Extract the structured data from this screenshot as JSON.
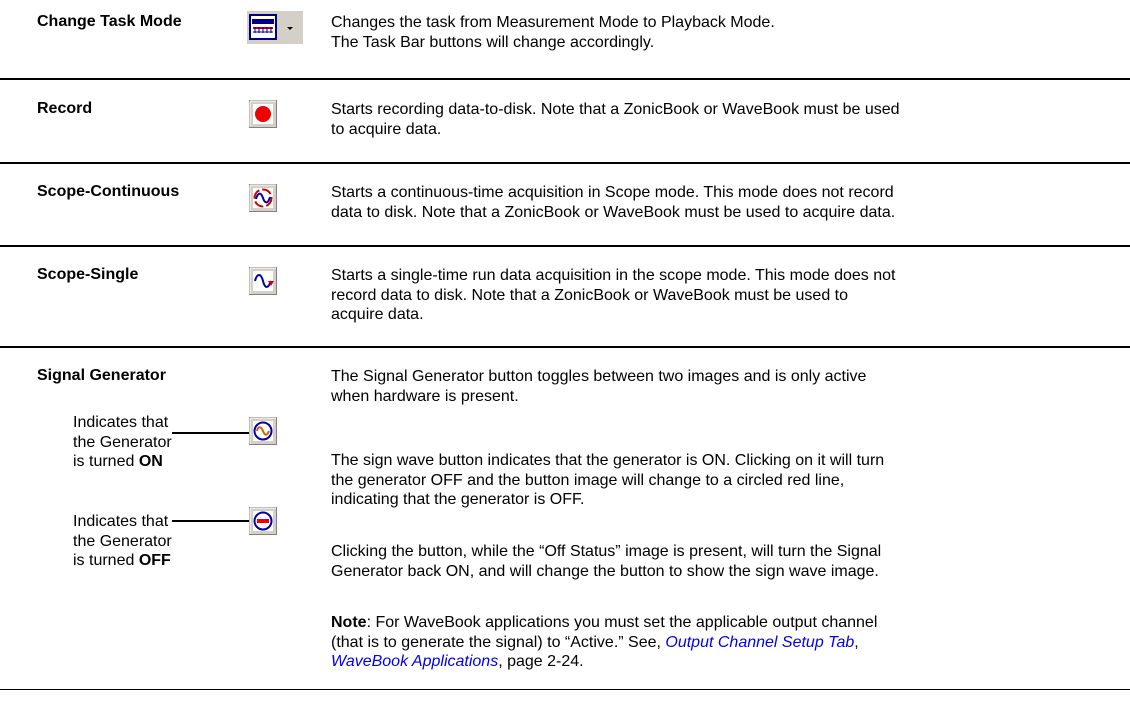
{
  "rows": [
    {
      "title": "Change Task Mode",
      "icon": "measurement-mode-dropdown-icon",
      "desc_lines": [
        "Changes the task from Measurement Mode to Playback Mode.",
        "The Task Bar buttons will change accordingly."
      ]
    },
    {
      "title": "Record",
      "icon": "record-icon",
      "desc_lines": [
        "Starts recording data-to-disk.  Note that a ZonicBook or WaveBook must be used",
        "to acquire data."
      ]
    },
    {
      "title": "Scope-Continuous",
      "icon": "scope-continuous-icon",
      "desc_lines": [
        "Starts a continuous-time acquisition in Scope mode.  This mode does not record",
        "data to disk.  Note that a ZonicBook or WaveBook must be used to acquire data."
      ]
    },
    {
      "title": "Scope-Single",
      "icon": "scope-single-icon",
      "desc_lines": [
        "Starts a single-time run data acquisition in the scope mode.  This mode does not",
        "record data to disk.  Note that a ZonicBook or WaveBook must be used to",
        "acquire data."
      ]
    }
  ],
  "signal": {
    "title": "Signal Generator",
    "intro_lines": [
      "The Signal Generator button toggles between two images and is only active",
      "when hardware is present."
    ],
    "on_label": {
      "line1": "Indicates that",
      "line2": "the Generator",
      "line3_prefix": "is turned ",
      "line3_bold": "ON"
    },
    "off_label": {
      "line1": "Indicates that",
      "line2": "the Generator",
      "line3_prefix": "is turned ",
      "line3_bold": "OFF"
    },
    "on_desc_lines": [
      "The sign wave button indicates that the generator is ON.  Clicking on it will turn",
      "the generator OFF and the button image will change to a circled red line,",
      "indicating that the generator is OFF."
    ],
    "off_desc_lines": [
      "Clicking the button, while the “Off Status” image is present, will turn the Signal",
      "Generator back ON, and will change the button to show the sign wave image."
    ],
    "note": {
      "label": "Note",
      "line1": ":  For WaveBook applications you must set the applicable output channel",
      "line2_prefix": "(that is to generate the signal) to “Active.”  See, ",
      "link1": "Output Channel Setup Tab",
      "line2_suffix": ",",
      "link2": "WaveBook Applications",
      "line3_suffix": ", page 2-24."
    }
  },
  "colors": {
    "record_red": "#ee0000",
    "icon_blue": "#0000aa",
    "button_face": "#d4d0c8",
    "link_blue": "#0000ee"
  }
}
